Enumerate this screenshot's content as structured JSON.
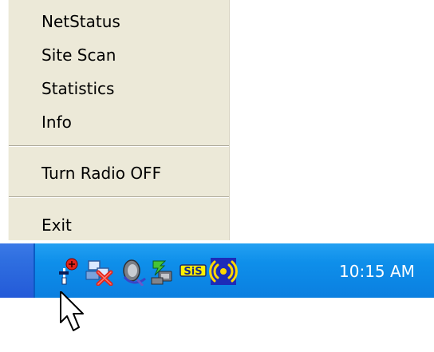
{
  "context_menu": {
    "items": [
      {
        "label": "NetStatus"
      },
      {
        "label": "Site Scan"
      },
      {
        "label": "Statistics"
      },
      {
        "label": "Info"
      },
      {
        "label": "Turn Radio OFF"
      },
      {
        "label": "Exit"
      }
    ]
  },
  "taskbar": {
    "tray_icons": [
      {
        "icon": "network-status-icon"
      },
      {
        "icon": "network-disconnected-icon"
      },
      {
        "icon": "speaker-icon"
      },
      {
        "icon": "network-connection-icon"
      },
      {
        "icon": "sis-icon"
      },
      {
        "icon": "wireless-radio-icon"
      }
    ],
    "clock": "10:15 AM"
  },
  "colors": {
    "menu_background": "#ece9d8",
    "taskbar_blue": "#245ad8",
    "tray_blue": "#0b7fe0",
    "clock_text": "#ffffff",
    "wireless_accent": "#ffd800",
    "disconnect_red": "#e2261c"
  }
}
